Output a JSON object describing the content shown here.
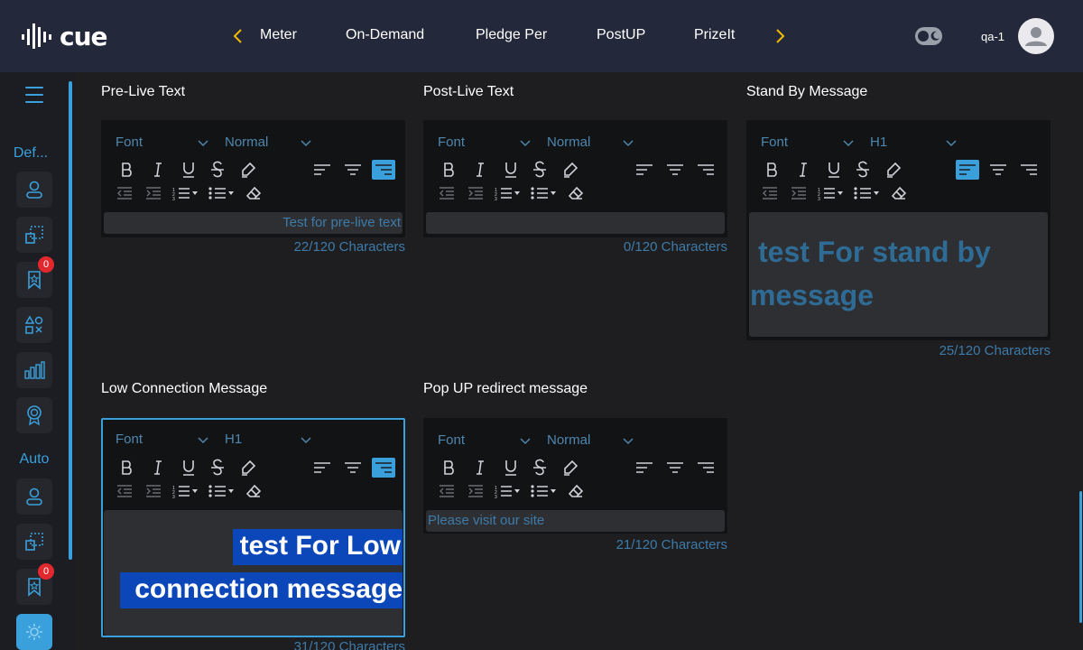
{
  "app": {
    "logo_text": "cue"
  },
  "nav": {
    "items": [
      "Meter",
      "On-Demand",
      "Pledge Per",
      "PostUP",
      "PrizeIt"
    ],
    "prev_icon": "chevron-left-icon",
    "next_icon": "chevron-right-icon"
  },
  "header": {
    "username": "qa-1",
    "theme_toggle": "dark-mode-toggle"
  },
  "sidebar": {
    "section1_label": "Def...",
    "section2_label": "Auto",
    "badge1": "0",
    "badge2": "0"
  },
  "colors": {
    "accent": "#3aa0dc",
    "nav_arrow": "#f5b800",
    "badge": "#e0282e",
    "topbar": "#23293a"
  },
  "editors": [
    {
      "title": "Pre-Live Text",
      "font": "Font",
      "size": "Normal",
      "content": "Test for pre-live text",
      "count": "22/120 Characters",
      "align": "right"
    },
    {
      "title": "Post-Live Text",
      "font": "Font",
      "size": "Normal",
      "content": "",
      "count": "0/120 Characters",
      "align": "left"
    },
    {
      "title": "Stand By Message",
      "font": "Font",
      "size": "H1",
      "content_line1": "test For stand by",
      "content_line2": "message",
      "count": "25/120 Characters",
      "align": "left"
    },
    {
      "title": "Low Connection Message",
      "font": "Font",
      "size": "H1",
      "content_line1": "test For Low",
      "content_line2": "connection message",
      "count": "31/120 Characters",
      "align": "right"
    },
    {
      "title": "Pop UP redirect message",
      "font": "Font",
      "size": "Normal",
      "content": "Please visit our site",
      "count": "21/120 Characters",
      "align": "left"
    }
  ]
}
